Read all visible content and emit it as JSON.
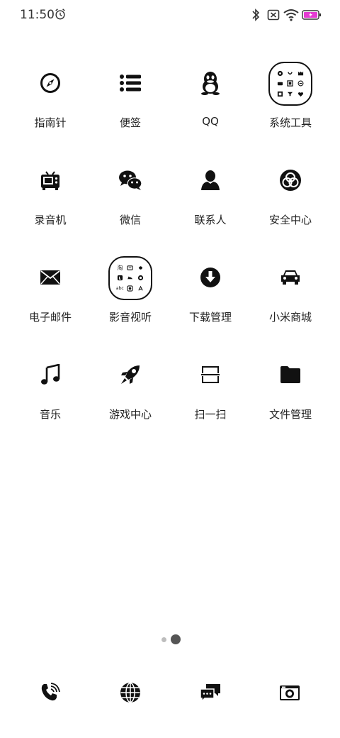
{
  "status_bar": {
    "time": "11:50"
  },
  "apps": [
    {
      "label": "指南针",
      "icon": "compass-icon"
    },
    {
      "label": "便签",
      "icon": "notes-list-icon"
    },
    {
      "label": "QQ",
      "icon": "qq-penguin-icon"
    },
    {
      "label": "系统工具",
      "icon": "folder"
    },
    {
      "label": "录音机",
      "icon": "recorder-icon"
    },
    {
      "label": "微信",
      "icon": "wechat-icon"
    },
    {
      "label": "联系人",
      "icon": "person-icon"
    },
    {
      "label": "安全中心",
      "icon": "security-icon"
    },
    {
      "label": "电子邮件",
      "icon": "mail-icon"
    },
    {
      "label": "影音视听",
      "icon": "folder"
    },
    {
      "label": "下载管理",
      "icon": "download-icon"
    },
    {
      "label": "小米商城",
      "icon": "car-shop-icon"
    },
    {
      "label": "音乐",
      "icon": "music-note-icon"
    },
    {
      "label": "游戏中心",
      "icon": "rocket-icon"
    },
    {
      "label": "扫一扫",
      "icon": "scan-icon"
    },
    {
      "label": "文件管理",
      "icon": "folder-file-icon"
    }
  ],
  "folder_media_text": {
    "top_left": "淘",
    "bottom_left": "abc"
  },
  "page_indicator": {
    "pages": 2,
    "current": 2
  },
  "dock": [
    {
      "icon": "phone-icon"
    },
    {
      "icon": "browser-globe-icon"
    },
    {
      "icon": "messages-icon"
    },
    {
      "icon": "camera-icon"
    }
  ],
  "colors": {
    "background": "#ffffff",
    "icon": "#111111",
    "label": "#222222",
    "battery_fill": "#e53bd2"
  }
}
